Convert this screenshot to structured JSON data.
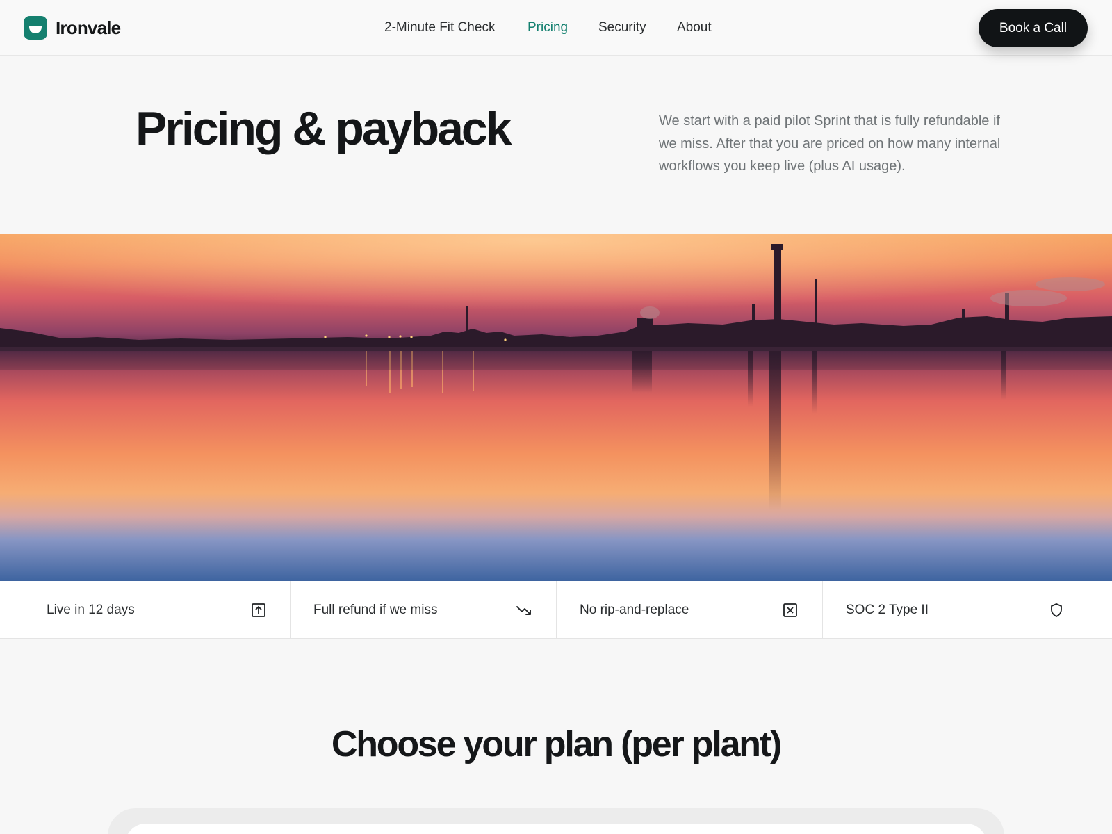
{
  "brand": {
    "name": "Ironvale",
    "accent_color": "#15806f"
  },
  "nav": {
    "items": [
      {
        "label": "2-Minute Fit Check",
        "active": false
      },
      {
        "label": "Pricing",
        "active": true
      },
      {
        "label": "Security",
        "active": false
      },
      {
        "label": "About",
        "active": false
      }
    ],
    "cta_label": "Book a Call"
  },
  "hero": {
    "title": "Pricing & payback",
    "description": "We start with a paid pilot Sprint that is fully refundable if we miss. After that you are priced on how many internal workflows you keep live (plus AI usage)."
  },
  "features": [
    {
      "label": "Live in 12 days",
      "icon": "arrow-up-square-icon"
    },
    {
      "label": "Full refund if we miss",
      "icon": "trending-down-icon"
    },
    {
      "label": "No rip-and-replace",
      "icon": "x-square-icon"
    },
    {
      "label": "SOC 2 Type II",
      "icon": "shield-icon"
    }
  ],
  "plans": {
    "title": "Choose your plan (per plant)"
  }
}
